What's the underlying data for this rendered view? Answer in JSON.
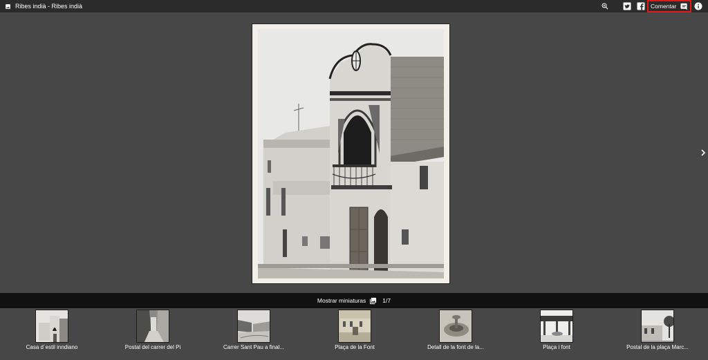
{
  "header": {
    "title": "Ribes indià - Ribes indià",
    "comment_label": "Comentar",
    "icons": [
      "image-icon",
      "zoom-in-icon",
      "twitter-icon",
      "facebook-icon",
      "comment-icon",
      "info-icon"
    ]
  },
  "viewer": {
    "show_thumbnails_label": "Mostrar miniaturas",
    "counter": "1/7"
  },
  "thumbnails": [
    {
      "caption": "Casa d´estil inndiano"
    },
    {
      "caption": "Postal del carrer del Pi"
    },
    {
      "caption": "Carrer Sant Pau a final..."
    },
    {
      "caption": "Plaça de la Font"
    },
    {
      "caption": "Detall de la font de la..."
    },
    {
      "caption": "Plaça i font"
    },
    {
      "caption": "Postal de la plaça Marc..."
    }
  ],
  "colors": {
    "topbar": "#2b2b2b",
    "stage": "#474747",
    "midbar": "#111111",
    "highlight": "#e41818"
  }
}
